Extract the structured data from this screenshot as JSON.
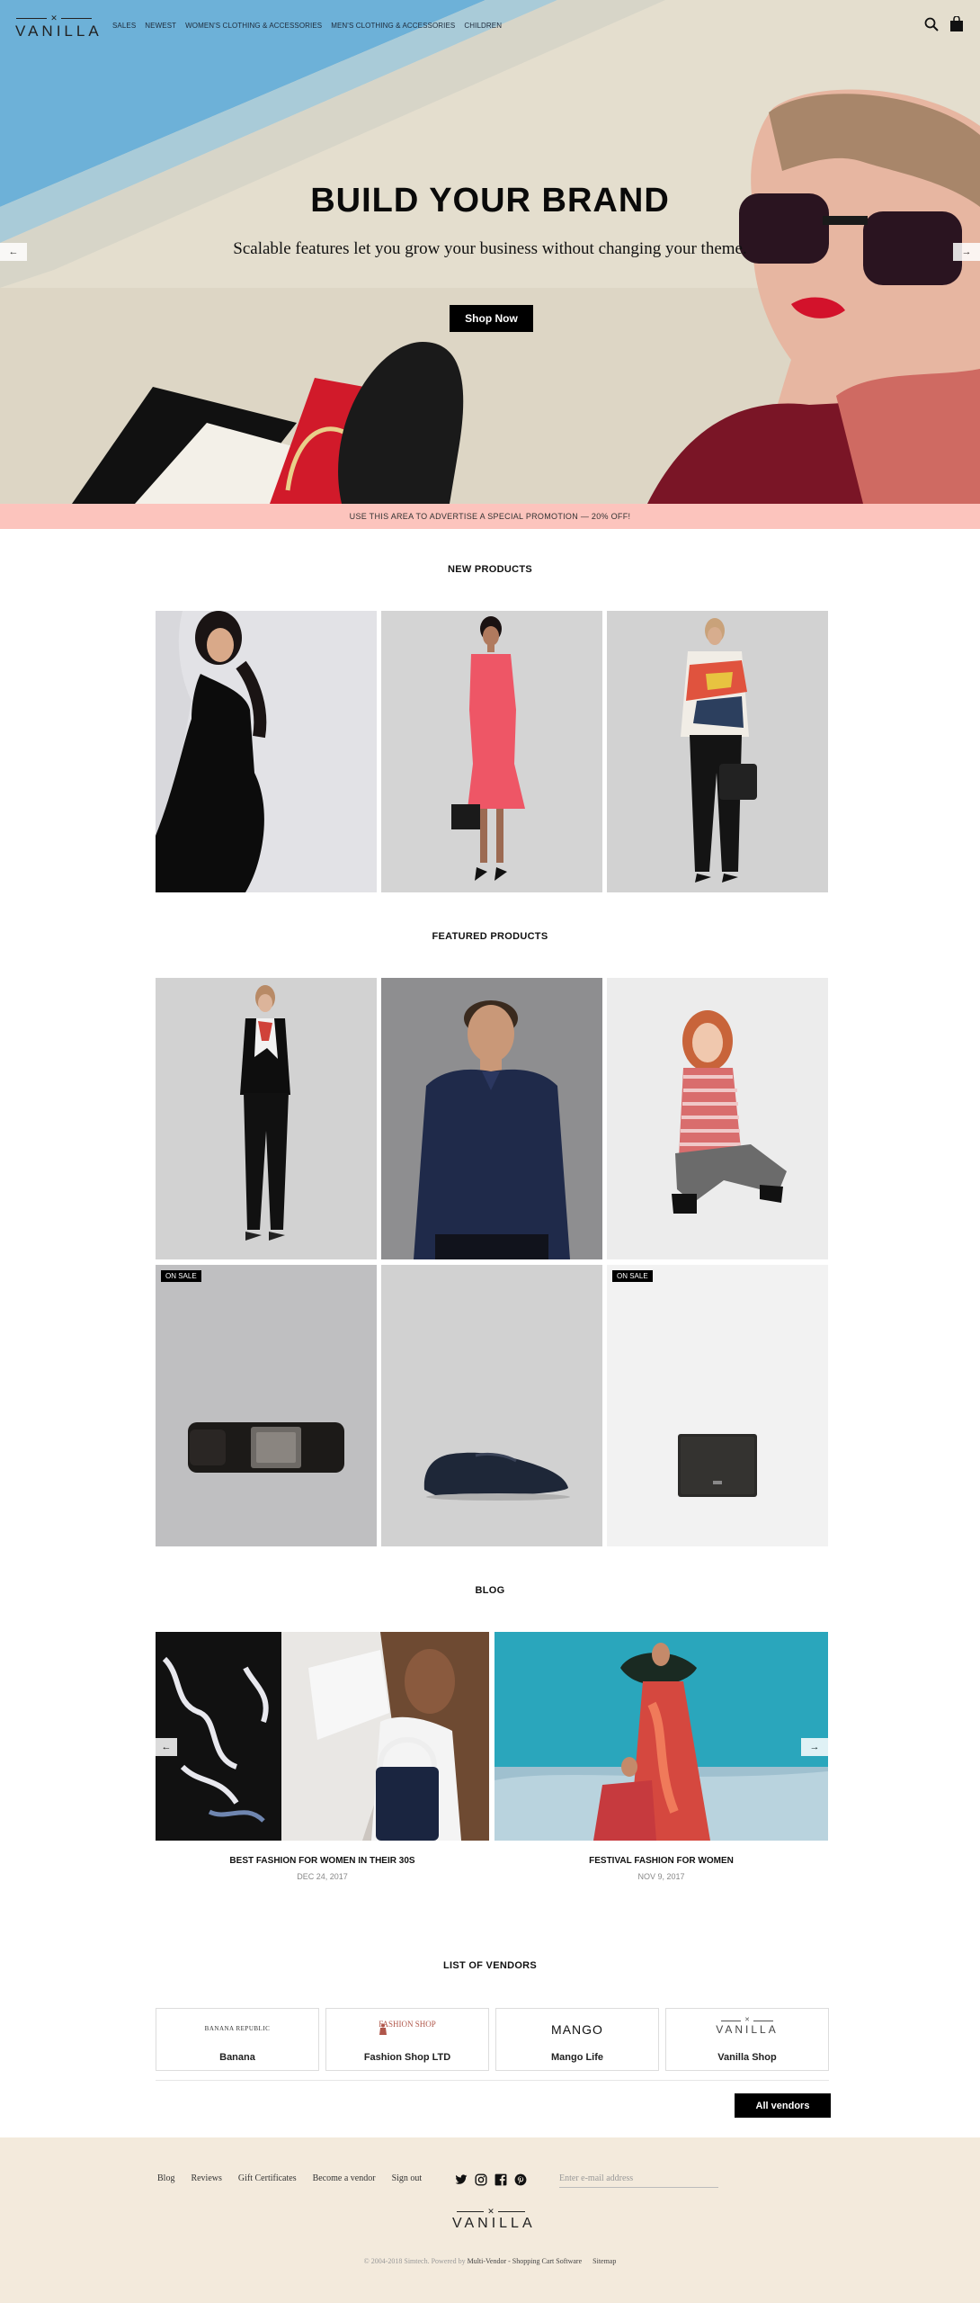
{
  "header": {
    "logo_text": "VANILLA",
    "nav": [
      "SALES",
      "NEWEST",
      "WOMEN'S CLOTHING & ACCESSORIES",
      "MEN'S CLOTHING & ACCESSORIES",
      "CHILDREN"
    ],
    "icons": [
      "search-icon",
      "bag-icon"
    ]
  },
  "hero": {
    "title": "BUILD YOUR BRAND",
    "subtitle": "Scalable features let you grow your business without changing your theme.",
    "button": "Shop Now",
    "prev_arrow": "←",
    "next_arrow": "→"
  },
  "promo": {
    "text": "USE THIS AREA TO ADVERTISE A SPECIAL PROMOTION — 20% OFF!"
  },
  "new_products": {
    "title": "NEW PRODUCTS"
  },
  "featured_products": {
    "title": "FEATURED PRODUCTS",
    "sale_badge": "ON SALE"
  },
  "blog": {
    "title": "BLOG",
    "posts": [
      {
        "title": "BEST FASHION FOR WOMEN IN THEIR 30S",
        "date": "DEC 24, 2017"
      },
      {
        "title": "FESTIVAL FASHION FOR WOMEN",
        "date": "NOV 9, 2017"
      }
    ],
    "prev_arrow": "←",
    "next_arrow": "→"
  },
  "vendors": {
    "title": "LIST OF VENDORS",
    "items": [
      {
        "name": "Banana",
        "logo": "BANANA REPUBLIC"
      },
      {
        "name": "Fashion Shop LTD",
        "logo": "FASHION SHOP"
      },
      {
        "name": "Mango Life",
        "logo": "MANGO"
      },
      {
        "name": "Vanilla Shop",
        "logo": "VANILLA"
      }
    ],
    "button": "All vendors"
  },
  "footer": {
    "links": [
      "Blog",
      "Reviews",
      "Gift Certificates",
      "Become a vendor",
      "Sign out"
    ],
    "social": [
      "twitter-icon",
      "instagram-icon",
      "facebook-icon",
      "pinterest-icon"
    ],
    "email_placeholder": "Enter e-mail address",
    "logo_text": "VANILLA",
    "copyright_prefix": "© 2004-2018 Simtech.  Powered by",
    "copyright_product": "Multi-Vendor - Shopping Cart Software",
    "sitemap": "Sitemap"
  },
  "colors": {
    "promo": "#fcc4bd",
    "footer": "#f3eadc",
    "button": "#000000"
  }
}
